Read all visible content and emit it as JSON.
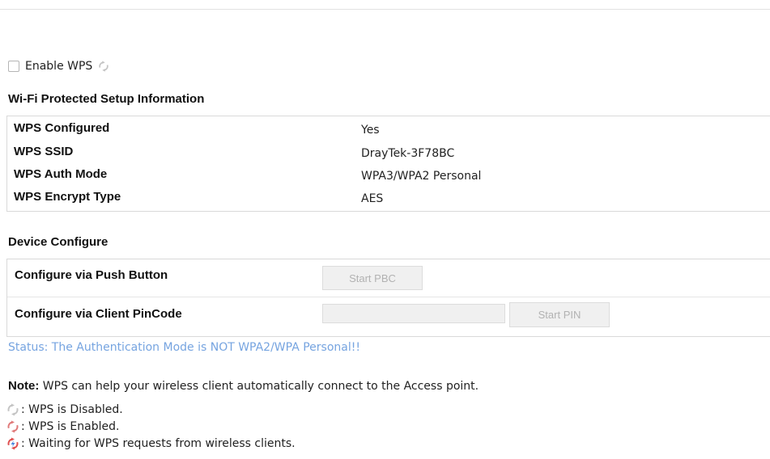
{
  "enable_wps": {
    "label": "Enable WPS",
    "checked": false,
    "icon": "wps-disabled-icon"
  },
  "info": {
    "title": "Wi-Fi Protected Setup Information",
    "rows": [
      {
        "key": "WPS Configured",
        "value": "Yes"
      },
      {
        "key": "WPS SSID",
        "value": "DrayTek-3F78BC"
      },
      {
        "key": "WPS Auth Mode",
        "value": "WPA3/WPA2 Personal"
      },
      {
        "key": "WPS Encrypt Type",
        "value": "AES"
      }
    ]
  },
  "device": {
    "title": "Device Configure",
    "push_label": "Configure via Push Button",
    "push_button": "Start PBC",
    "pin_label": "Configure via Client PinCode",
    "pin_value": "",
    "pin_button": "Start PIN"
  },
  "status": "Status: The Authentication Mode is NOT WPA2/WPA Personal!!",
  "note": {
    "label": "Note:",
    "text": " WPS can help your wireless client automatically connect to the Access point.",
    "legend": [
      {
        "icon": "wps-disabled-icon",
        "text": ": WPS is Disabled."
      },
      {
        "icon": "wps-enabled-icon",
        "text": ": WPS is Enabled."
      },
      {
        "icon": "wps-waiting-icon",
        "text": ": Waiting for WPS requests from wireless clients."
      }
    ]
  },
  "colors": {
    "status_text": "#76a4e0",
    "icon_disabled": "#c4c4c4",
    "icon_enabled": "#e07a7a",
    "icon_waiting_red": "#e05050",
    "icon_waiting_blue": "#4a88e0"
  }
}
